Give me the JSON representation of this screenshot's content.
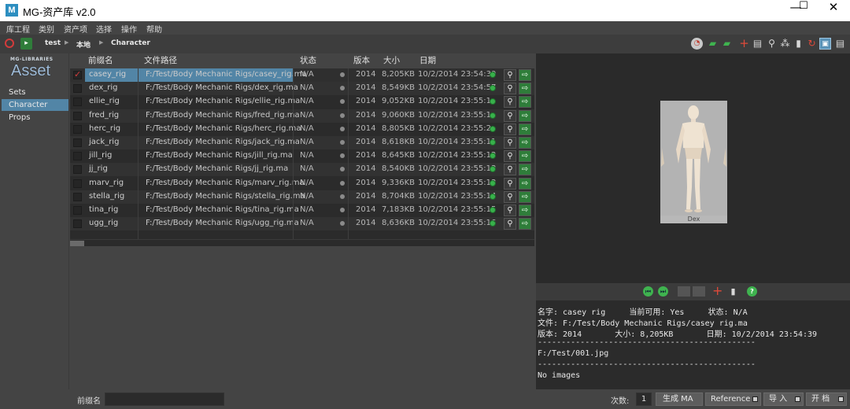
{
  "window": {
    "title": "MG-资产库 v2.0",
    "icon_letter": "M",
    "minimize": "—",
    "maximize": "☐",
    "close": "✕"
  },
  "menu": [
    "库工程",
    "类别",
    "资产项",
    "选择",
    "操作",
    "帮助"
  ],
  "breadcrumb": [
    "test",
    "本地",
    "Character"
  ],
  "sidebar": {
    "logo_small": "MG-LIBRARIES",
    "logo_big": "Asset",
    "items": [
      {
        "label": "Sets",
        "active": false
      },
      {
        "label": "Character",
        "active": true
      },
      {
        "label": "Props",
        "active": false
      }
    ]
  },
  "table": {
    "headers": {
      "name": "前缀名",
      "path": "文件路径",
      "status": "状态",
      "version": "版本",
      "size": "大小",
      "date": "日期"
    },
    "rows": [
      {
        "name": "casey_rig",
        "path": "F:/Test/Body Mechanic Rigs/casey_rig.ma",
        "status": "N/A",
        "version": "2014",
        "size": "8,205KB",
        "date": "10/2/2014 23:54:39",
        "checked": true
      },
      {
        "name": "dex_rig",
        "path": "F:/Test/Body Mechanic Rigs/dex_rig.ma",
        "status": "N/A",
        "version": "2014",
        "size": "8,549KB",
        "date": "10/2/2014 23:54:57",
        "checked": false
      },
      {
        "name": "ellie_rig",
        "path": "F:/Test/Body Mechanic Rigs/ellie_rig.ma",
        "status": "N/A",
        "version": "2014",
        "size": "9,052KB",
        "date": "10/2/2014 23:55:1",
        "checked": false
      },
      {
        "name": "fred_rig",
        "path": "F:/Test/Body Mechanic Rigs/fred_rig.ma",
        "status": "N/A",
        "version": "2014",
        "size": "9,060KB",
        "date": "10/2/2014 23:55:1",
        "checked": false
      },
      {
        "name": "herc_rig",
        "path": "F:/Test/Body Mechanic Rigs/herc_rig.ma",
        "status": "N/A",
        "version": "2014",
        "size": "8,805KB",
        "date": "10/2/2014 23:55:2",
        "checked": false
      },
      {
        "name": "jack_rig",
        "path": "F:/Test/Body Mechanic Rigs/jack_rig.ma",
        "status": "N/A",
        "version": "2014",
        "size": "8,618KB",
        "date": "10/2/2014 23:55:11",
        "checked": false
      },
      {
        "name": "jill_rig",
        "path": "F:/Test/Body Mechanic Rigs/jill_rig.ma",
        "status": "N/A",
        "version": "2014",
        "size": "8,645KB",
        "date": "10/2/2014 23:55:12",
        "checked": false
      },
      {
        "name": "jj_rig",
        "path": "F:/Test/Body Mechanic Rigs/jj_rig.ma",
        "status": "N/A",
        "version": "2014",
        "size": "8,540KB",
        "date": "10/2/2014 23:55:13",
        "checked": false
      },
      {
        "name": "marv_rig",
        "path": "F:/Test/Body Mechanic Rigs/marv_rig.ma",
        "status": "N/A",
        "version": "2014",
        "size": "9,336KB",
        "date": "10/2/2014 23:55:13",
        "checked": false
      },
      {
        "name": "stella_rig",
        "path": "F:/Test/Body Mechanic Rigs/stella_rig.ma",
        "status": "N/A",
        "version": "2014",
        "size": "8,704KB",
        "date": "10/2/2014 23:55:14",
        "checked": false
      },
      {
        "name": "tina_rig",
        "path": "F:/Test/Body Mechanic Rigs/tina_rig.ma",
        "status": "N/A",
        "version": "2014",
        "size": "7,183KB",
        "date": "10/2/2014 23:55:15",
        "checked": false
      },
      {
        "name": "ugg_rig",
        "path": "F:/Test/Body Mechanic Rigs/ugg_rig.ma",
        "status": "N/A",
        "version": "2014",
        "size": "8,636KB",
        "date": "10/2/2014 23:55:16",
        "checked": false
      }
    ]
  },
  "preview": {
    "caption": "Dex"
  },
  "info": {
    "lines": [
      "名字: casey_rig     当前可用: Yes     状态: N/A",
      "文件: F:/Test/Body Mechanic Rigs/casey_rig.ma",
      "版本: 2014       大小: 8,205KB       日期: 10/2/2014 23:54:39",
      "----------------------------------------------",
      "F:/Test/001.jpg",
      "----------------------------------------------",
      "No images"
    ]
  },
  "bottom": {
    "prefix_label": "前缀名",
    "prefix_value": "",
    "count_label": "次数:",
    "count_value": "1",
    "btn_generate": "生成 MA",
    "btn_reference": "Reference",
    "btn_import": "导 入",
    "btn_open": "开 档"
  },
  "colors": {
    "selection": "#5285a6",
    "accent_green": "#38b04b",
    "accent_red": "#d23b3b"
  }
}
